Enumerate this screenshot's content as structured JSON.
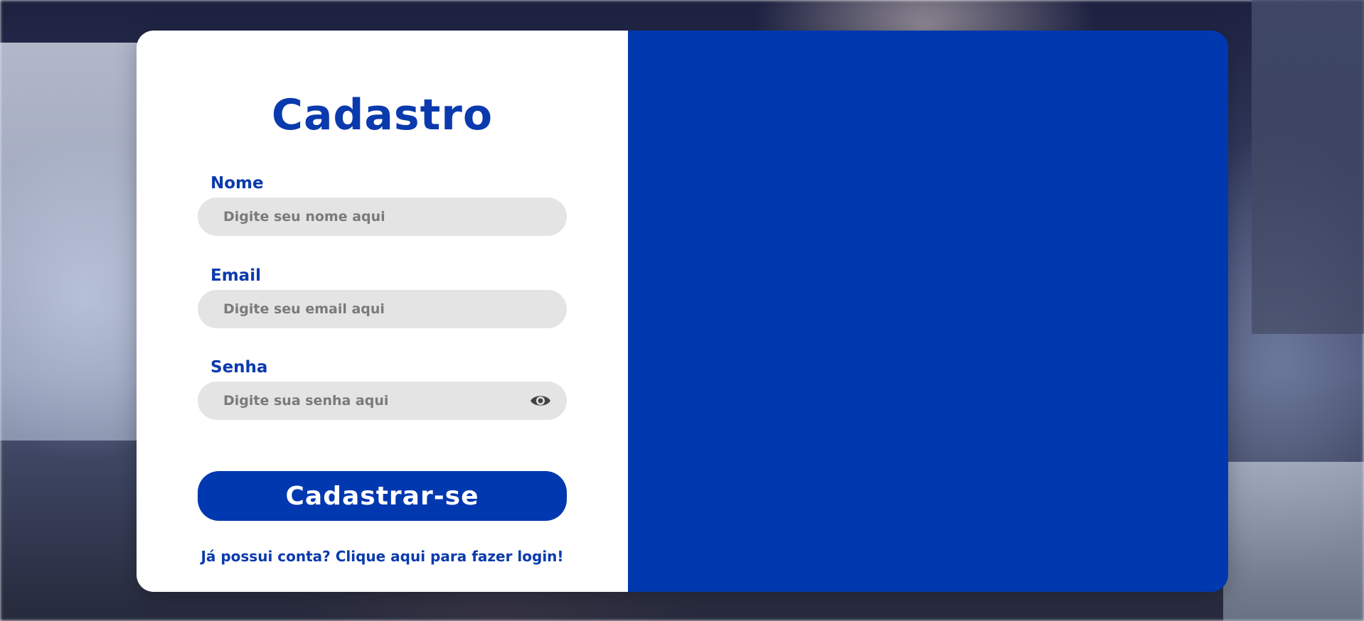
{
  "form": {
    "title": "Cadastro",
    "fields": [
      {
        "label": "Nome",
        "placeholder": "Digite seu nome aqui",
        "value": ""
      },
      {
        "label": "Email",
        "placeholder": "Digite seu email aqui",
        "value": ""
      },
      {
        "label": "Senha",
        "placeholder": "Digite sua senha aqui",
        "value": "",
        "icon": "eye-icon"
      }
    ],
    "submit_label": "Cadastrar-se",
    "login_link": "Já possui conta? Clique aqui para fazer login!"
  },
  "colors": {
    "primary": "#0038b0",
    "title": "#0a3aad",
    "input_bg": "#e4e4e4",
    "card_bg": "#ffffff"
  }
}
